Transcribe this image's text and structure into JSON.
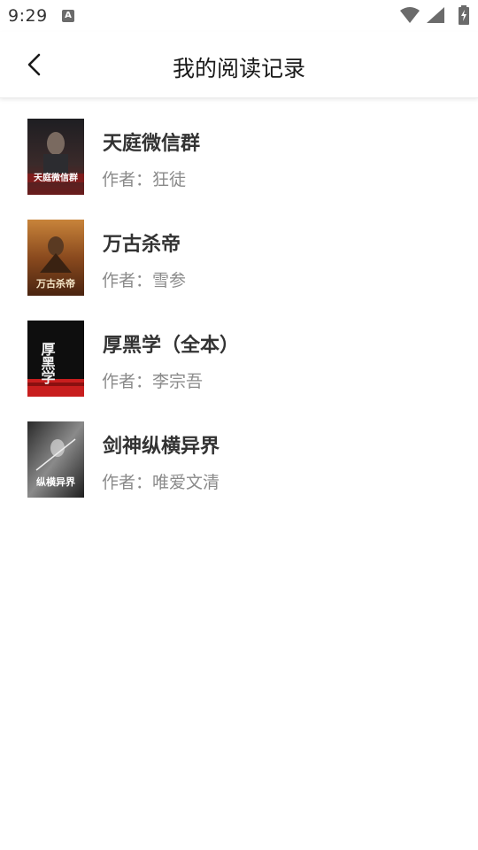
{
  "status_bar": {
    "time": "9:29",
    "notification_icon_letter": "A",
    "icons": [
      "wifi-icon",
      "signal-icon",
      "battery-charging-icon"
    ]
  },
  "header": {
    "title": "我的阅读记录",
    "back_icon": "chevron-left-icon"
  },
  "author_prefix": "作者：",
  "books": [
    {
      "title": "天庭微信群",
      "author": "狂徒",
      "cover_text": "天庭微信群",
      "cover_colors": [
        "#2a2a2e",
        "#6a1c1c"
      ]
    },
    {
      "title": "万古杀帝",
      "author": "雪参",
      "cover_text": "万古杀帝",
      "cover_colors": [
        "#b86a2a",
        "#5a2a12"
      ]
    },
    {
      "title": "厚黑学（全本）",
      "author": "李宗吾",
      "cover_text": "厚黑学",
      "cover_colors": [
        "#111111",
        "#c81e1e"
      ]
    },
    {
      "title": "剑神纵横异界",
      "author": "唯爱文清",
      "cover_text": "纵横异界",
      "cover_colors": [
        "#3a3a3a",
        "#9a9a9a"
      ]
    }
  ]
}
